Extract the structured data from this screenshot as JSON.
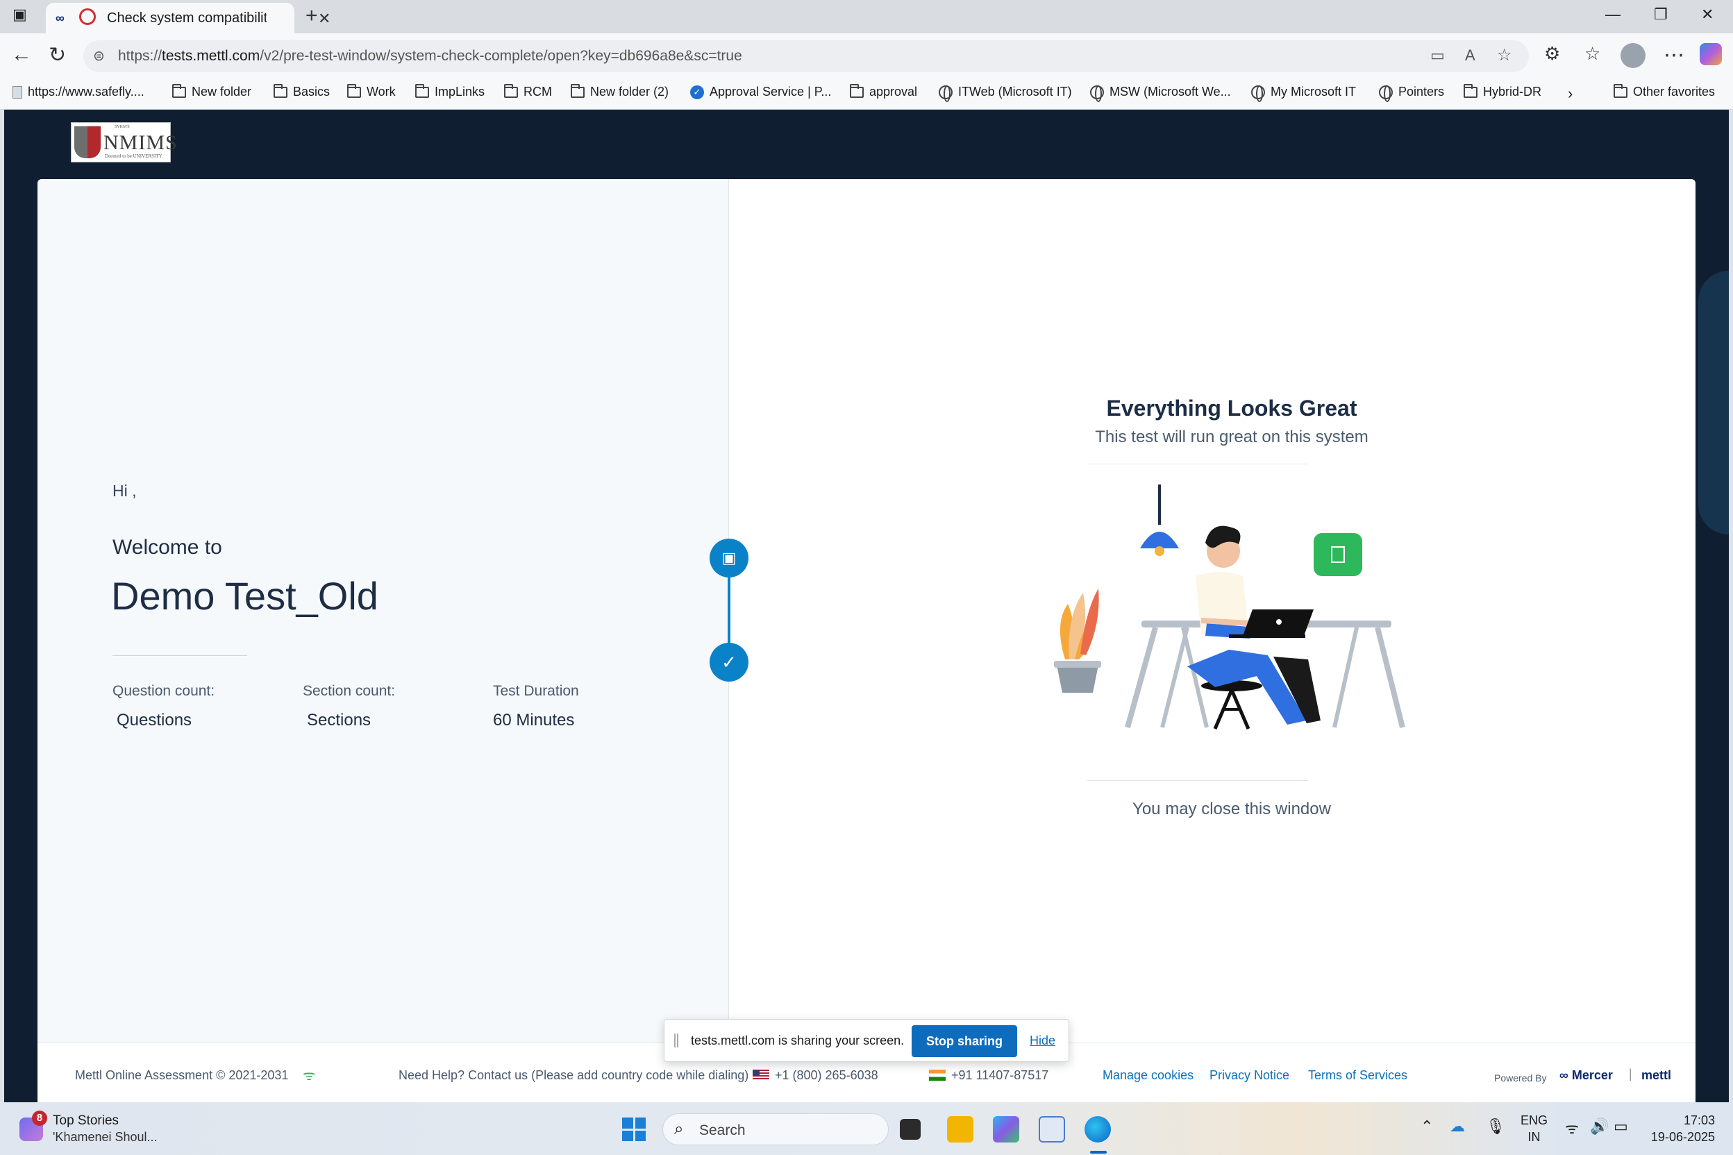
{
  "browser": {
    "tab_title": "Check system compatibility",
    "url_prefix": "https://",
    "url_host": "tests.mettl.com",
    "url_path": "/v2/pre-test-window/system-check-complete/open?key=db696a8e&sc=true",
    "bookmarks": [
      "https://www.safefly....",
      "New folder",
      "Basics",
      "Work",
      "ImpLinks",
      "RCM",
      "New folder (2)",
      "Approval Service | P...",
      "approval",
      "ITWeb (Microsoft IT)",
      "MSW (Microsoft We...",
      "My Microsoft IT",
      "Pointers",
      "Hybrid-DR",
      "Other favorites"
    ]
  },
  "page": {
    "logo_text": "NMIMS",
    "logo_subtext": "Deemed to be UNIVERSITY",
    "logo_top": "SVKM'S",
    "greeting": "Hi ,",
    "welcome": "Welcome to",
    "test_name": "Demo Test_Old",
    "question_label": "Question count:",
    "question_value": "Questions",
    "section_label": "Section count:",
    "section_value": "Sections",
    "duration_label": "Test Duration",
    "duration_value": "60  Minutes",
    "success_title": "Everything Looks Great",
    "success_subtitle": "This test will run great on this system",
    "close_message": "You may close this window"
  },
  "footer": {
    "copyright": "Mettl Online Assessment © 2021-2031",
    "help": "Need Help? Contact us (Please add country code while dialing)",
    "phone_us": "+1 (800) 265-6038",
    "phone_in": "+91 11407-87517",
    "manage_cookies": "Manage cookies",
    "privacy": "Privacy Notice",
    "terms": "Terms of Services",
    "powered_by": "Powered By",
    "mercer": "Mercer",
    "mettl": "mettl"
  },
  "sharebar": {
    "message": "tests.mettl.com is sharing your screen.",
    "stop_label": "Stop sharing",
    "hide_label": "Hide"
  },
  "taskbar": {
    "news_badge": "8",
    "news_title": "Top Stories",
    "news_subtitle": "'Khamenei Shoul...",
    "search_label": "Search",
    "lang_line1": "ENG",
    "lang_line2": "IN",
    "time": "17:03",
    "date": "19-06-2025"
  },
  "colors": {
    "page_bg": "#0f1e30",
    "accent": "#0a82c8",
    "success_green": "#2eb85c",
    "lamp_blue": "#2f6fe0"
  }
}
